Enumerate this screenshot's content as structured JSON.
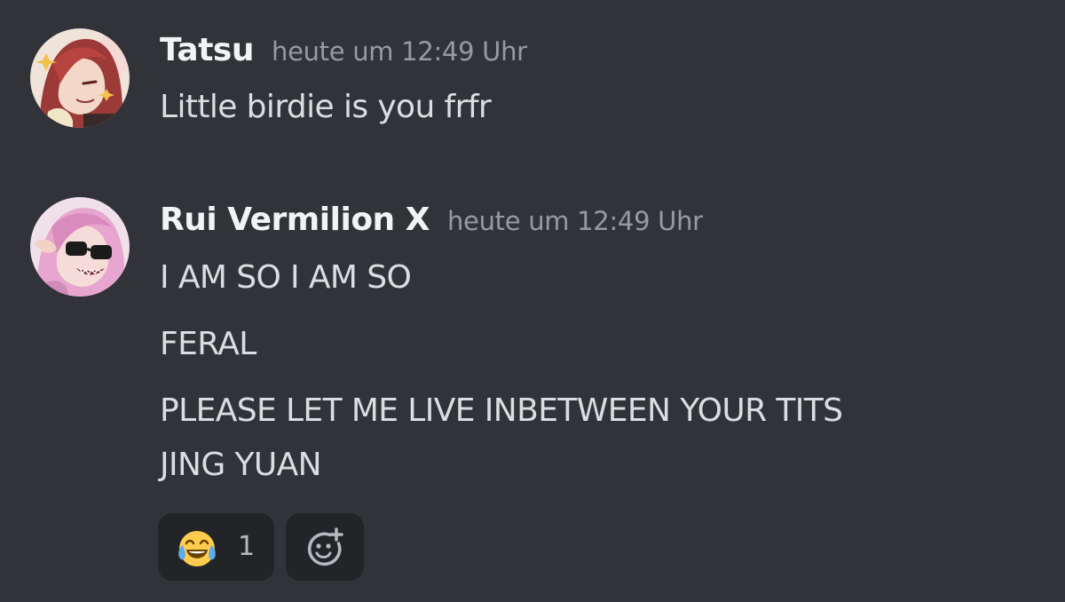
{
  "messages": [
    {
      "username": "Tatsu",
      "timestamp": "heute um 12:49 Uhr",
      "avatar_icon": "anime-avatar-red-hair",
      "lines": [
        "Little birdie is you frfr"
      ]
    },
    {
      "username": "Rui Vermilion X",
      "timestamp": "heute um 12:49 Uhr",
      "avatar_icon": "anime-avatar-pink-hair-sunglasses",
      "lines": [
        "I AM SO I AM SO",
        "FERAL",
        "PLEASE LET ME LIVE INBETWEEN YOUR TITS",
        "JING YUAN"
      ],
      "reactions": [
        {
          "emoji_icon": "joy-emoji",
          "count": "1"
        }
      ],
      "add_reaction_icon": "add-reaction-icon"
    }
  ],
  "colors": {
    "background": "#313338",
    "username": "#f2f3f5",
    "timestamp": "#949ba4",
    "message_text": "#dbdee1",
    "reaction_bg": "#232428"
  }
}
